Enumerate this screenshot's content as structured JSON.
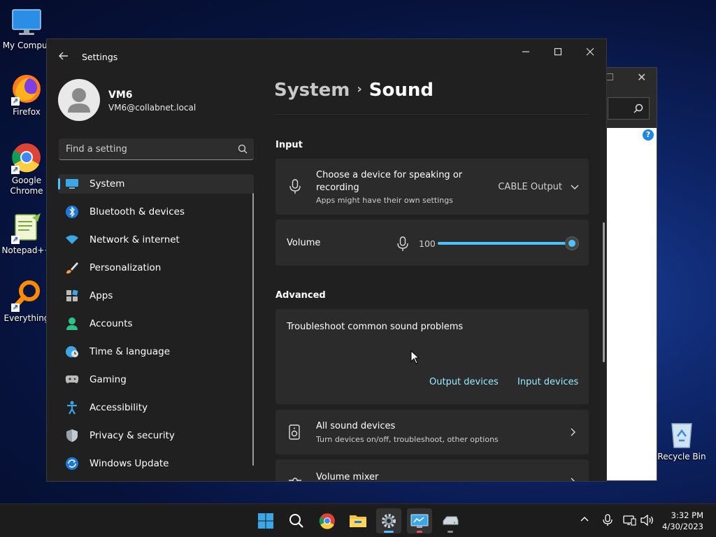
{
  "desktop": {
    "icons": [
      {
        "label": "My Comput"
      },
      {
        "label": "Firefox"
      },
      {
        "label": "Google Chrome"
      },
      {
        "label": "Notepad++"
      },
      {
        "label": "Everything"
      },
      {
        "label": "Recycle Bin"
      }
    ]
  },
  "window": {
    "title": "Settings",
    "minimize_icon": "minimize-icon",
    "maximize_icon": "maximize-icon",
    "close_icon": "close-icon"
  },
  "profile": {
    "name": "VM6",
    "email": "VM6@collabnet.local"
  },
  "search": {
    "placeholder": "Find a setting"
  },
  "sidebar": {
    "items": [
      {
        "label": "System",
        "icon": "system-icon",
        "active": true
      },
      {
        "label": "Bluetooth & devices",
        "icon": "bluetooth-icon"
      },
      {
        "label": "Network & internet",
        "icon": "wifi-icon"
      },
      {
        "label": "Personalization",
        "icon": "brush-icon"
      },
      {
        "label": "Apps",
        "icon": "apps-icon"
      },
      {
        "label": "Accounts",
        "icon": "accounts-icon"
      },
      {
        "label": "Time & language",
        "icon": "globe-clock-icon"
      },
      {
        "label": "Gaming",
        "icon": "gamepad-icon"
      },
      {
        "label": "Accessibility",
        "icon": "accessibility-icon"
      },
      {
        "label": "Privacy & security",
        "icon": "shield-icon"
      },
      {
        "label": "Windows Update",
        "icon": "update-icon"
      }
    ]
  },
  "breadcrumb": {
    "parent": "System",
    "separator": "›",
    "current": "Sound"
  },
  "input_section": {
    "heading": "Input",
    "device_card": {
      "title_line1": "Choose a device for speaking or",
      "title_line2": "recording",
      "subtitle": "Apps might have their own settings",
      "selected_device": "CABLE Output"
    },
    "volume_card": {
      "label": "Volume",
      "value": "100",
      "level_percent": 100
    }
  },
  "advanced_section": {
    "heading": "Advanced",
    "troubleshoot_card": {
      "title": "Troubleshoot common sound problems",
      "link_output": "Output devices",
      "link_input": "Input devices"
    },
    "all_devices_card": {
      "title": "All sound devices",
      "subtitle": "Turn devices on/off, troubleshoot, other options"
    },
    "mixer_card": {
      "title": "Volume mixer"
    }
  },
  "taskbar": {
    "time": "3:32 PM",
    "date": "4/30/2023"
  },
  "colors": {
    "accent": "#4cc2ff",
    "link": "#99ebff",
    "window_bg": "#202020",
    "card_bg": "#2b2b2b"
  }
}
